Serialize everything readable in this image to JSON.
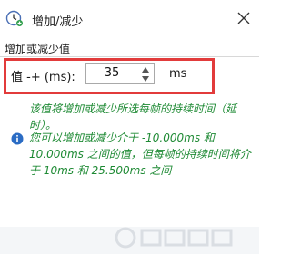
{
  "window": {
    "title": "增加/减少",
    "title_icon": "clock-plus-icon",
    "close_icon": "close-icon"
  },
  "section": {
    "label": "增加或减少值"
  },
  "field": {
    "label": "值 -+ (ms):",
    "value": "35",
    "unit": "ms"
  },
  "description": "该值将增加或减少所选每帧的持续时间（延时）。",
  "info": {
    "icon": "info-icon",
    "text": "您可以增加或减少介于 -10.000ms 和 10.000ms 之间的值，但每帧的持续时间将介于 10ms 和 25.500ms 之间"
  },
  "colors": {
    "highlight": "#e23b3b",
    "hint_text": "#1e8a34",
    "info_icon": "#2b6cc4"
  }
}
